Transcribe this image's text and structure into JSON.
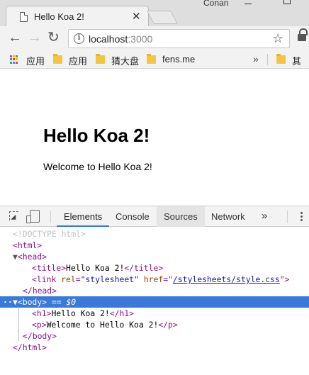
{
  "browser": {
    "tab_title": "Hello Koa 2!",
    "tab_close": "✕",
    "profile_name": "Conan",
    "url_host": "localhost",
    "url_port": ":3000",
    "back_glyph": "←",
    "forward_glyph": "→",
    "reload_glyph": "↻",
    "info_glyph": "i",
    "star_glyph": "☆",
    "apps_colors": [
      "#e94235",
      "#fbbc04",
      "#34a853",
      "#4285f4",
      "#e94235",
      "#fbbc04",
      "#34a853",
      "#4285f4",
      "#e94235"
    ]
  },
  "bookmarks": {
    "items": [
      {
        "label": "应用",
        "icon": "apps-icon"
      },
      {
        "label": "应用",
        "icon": "folder-icon"
      },
      {
        "label": "猜大盘",
        "icon": "folder-icon"
      },
      {
        "label": "fens.me",
        "icon": "folder-icon"
      }
    ],
    "more_glyph": "»",
    "other_label": "其他"
  },
  "page": {
    "heading": "Hello Koa 2!",
    "paragraph": "Welcome to Hello Koa 2!"
  },
  "devtools": {
    "tabs": [
      "Elements",
      "Console",
      "Sources",
      "Network"
    ],
    "more_tabs_glyph": "»",
    "accent_color": "#3879d9",
    "dom": {
      "doctype": "<!DOCTYPE html>",
      "html_open": "<html>",
      "head_open": "<head>",
      "title_open": "<title>",
      "title_text": "Hello Koa 2!",
      "title_close": "</title>",
      "link_tag_open": "<link",
      "link_rel_name": "rel",
      "link_rel_value": "\"stylesheet\"",
      "link_href_name": "href",
      "link_href_value": "/stylesheets/style.css",
      "link_tag_close": ">",
      "head_close": "</head>",
      "body_open": "<body>",
      "selected_marker": "== $0",
      "h1_open": "<h1>",
      "h1_text": "Hello Koa 2!",
      "h1_close": "</h1>",
      "p_open": "<p>",
      "p_text": "Welcome to Hello Koa 2!",
      "p_close": "</p>",
      "body_close": "</body>",
      "html_close": "</html>"
    }
  }
}
